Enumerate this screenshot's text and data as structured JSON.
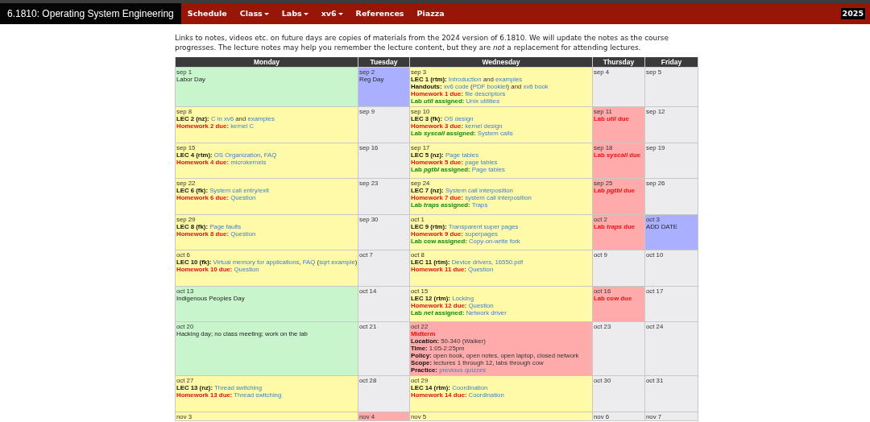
{
  "site_title": "6.1810: Operating System Engineering",
  "nav": [
    {
      "label": "Schedule",
      "dropdown": false
    },
    {
      "label": "Class",
      "dropdown": true
    },
    {
      "label": "Labs",
      "dropdown": true
    },
    {
      "label": "xv6",
      "dropdown": true
    },
    {
      "label": "References",
      "dropdown": false
    },
    {
      "label": "Piazza",
      "dropdown": false
    }
  ],
  "year": "2025",
  "intro": "Links to notes, videos etc. on future days are copies of materials from the 2024 version of 6.1810. We will update the notes as the course progresses. The lecture notes may help you remember the lecture content, but they are *not* a replacement for attending lectures.",
  "days": [
    "Monday",
    "Tuesday",
    "Wednesday",
    "Thursday",
    "Friday"
  ],
  "weeks": [
    [
      {
        "date": "sep 1",
        "kind": "holiday",
        "lines": [
          {
            "kind": "note",
            "parts": [
              {
                "text": "Labor Day"
              }
            ]
          }
        ]
      },
      {
        "date": "sep 2",
        "kind": "special",
        "lines": [
          {
            "kind": "note",
            "parts": [
              {
                "text": "Reg Day"
              }
            ]
          }
        ]
      },
      {
        "date": "sep 3",
        "kind": "class",
        "lines": [
          {
            "kind": "lec",
            "label": "LEC 1 (rtm):",
            "parts": [
              {
                "text": "Introduction",
                "link": true
              },
              {
                "text": " and "
              },
              {
                "text": "examples",
                "link": true
              }
            ]
          },
          {
            "kind": "lec",
            "label": "Handouts:",
            "parts": [
              {
                "text": "xv6 code",
                "link": true
              },
              {
                "text": " ("
              },
              {
                "text": "PDF booklet",
                "link": true
              },
              {
                "text": ") and "
              },
              {
                "text": "xv6 book",
                "link": true
              }
            ]
          },
          {
            "kind": "hw",
            "label": "Homework 1 due:",
            "parts": [
              {
                "text": "file descriptors",
                "link": true
              }
            ]
          },
          {
            "kind": "lab",
            "label": "Lab *util* assigned:",
            "parts": [
              {
                "text": "Unix utilities",
                "link": true
              }
            ]
          }
        ]
      },
      {
        "date": "sep 4",
        "kind": "empty"
      },
      {
        "date": "sep 5",
        "kind": "empty"
      }
    ],
    [
      {
        "date": "sep 8",
        "kind": "class",
        "lines": [
          {
            "kind": "lec",
            "label": "LEC 2 (nz):",
            "parts": [
              {
                "text": "C in xv6",
                "link": true
              },
              {
                "text": " and "
              },
              {
                "text": "examples",
                "link": true
              }
            ]
          },
          {
            "kind": "hw",
            "label": "Homework 2 due:",
            "parts": [
              {
                "text": "kernel C",
                "link": true
              }
            ]
          }
        ]
      },
      {
        "date": "sep 9",
        "kind": "empty"
      },
      {
        "date": "sep 10",
        "kind": "class",
        "lines": [
          {
            "kind": "lec",
            "label": "LEC 3 (fk):",
            "parts": [
              {
                "text": "OS design",
                "link": true
              }
            ]
          },
          {
            "kind": "hw",
            "label": "Homework 3 due:",
            "parts": [
              {
                "text": "kernel design",
                "link": true
              }
            ]
          },
          {
            "kind": "lab",
            "label": "Lab *syscall* assigned:",
            "parts": [
              {
                "text": "System calls",
                "link": true
              }
            ]
          }
        ]
      },
      {
        "date": "sep 11",
        "kind": "due",
        "lines": [
          {
            "kind": "hw",
            "label": "Lab *util* due"
          }
        ]
      },
      {
        "date": "sep 12",
        "kind": "empty"
      }
    ],
    [
      {
        "date": "sep 15",
        "kind": "class",
        "lines": [
          {
            "kind": "lec",
            "label": "LEC 4 (rtm):",
            "parts": [
              {
                "text": "OS Organization",
                "link": true
              },
              {
                "text": ", "
              },
              {
                "text": "FAQ",
                "link": true
              }
            ]
          },
          {
            "kind": "hw",
            "label": "Homework 4 due:",
            "parts": [
              {
                "text": "microkernels",
                "link": true
              }
            ]
          }
        ]
      },
      {
        "date": "sep 16",
        "kind": "empty"
      },
      {
        "date": "sep 17",
        "kind": "class",
        "lines": [
          {
            "kind": "lec",
            "label": "LEC 5 (nz):",
            "parts": [
              {
                "text": "Page tables",
                "link": true
              }
            ]
          },
          {
            "kind": "hw",
            "label": "Homework 5 due:",
            "parts": [
              {
                "text": "page tables",
                "link": true
              }
            ]
          },
          {
            "kind": "lab",
            "label": "Lab *pgtbl* assigned:",
            "parts": [
              {
                "text": "Page tables",
                "link": true
              }
            ]
          }
        ]
      },
      {
        "date": "sep 18",
        "kind": "due",
        "lines": [
          {
            "kind": "hw",
            "label": "Lab *syscall* due"
          }
        ]
      },
      {
        "date": "sep 19",
        "kind": "empty"
      }
    ],
    [
      {
        "date": "sep 22",
        "kind": "class",
        "lines": [
          {
            "kind": "lec",
            "label": "LEC 6 (fk):",
            "parts": [
              {
                "text": "System call entry/exit",
                "link": true
              }
            ]
          },
          {
            "kind": "hw",
            "label": "Homework 6 due:",
            "parts": [
              {
                "text": "Question",
                "link": true
              }
            ]
          }
        ]
      },
      {
        "date": "sep 23",
        "kind": "empty"
      },
      {
        "date": "sep 24",
        "kind": "class",
        "lines": [
          {
            "kind": "lec",
            "label": "LEC 7 (nz):",
            "parts": [
              {
                "text": "System call interposition",
                "link": true
              }
            ]
          },
          {
            "kind": "hw",
            "label": "Homework 7 due:",
            "parts": [
              {
                "text": "system call interposition",
                "link": true
              }
            ]
          },
          {
            "kind": "lab",
            "label": "Lab *traps* assigned:",
            "parts": [
              {
                "text": "Traps",
                "link": true
              }
            ]
          }
        ]
      },
      {
        "date": "sep 25",
        "kind": "due",
        "lines": [
          {
            "kind": "hw",
            "label": "Lab *pgtbl* due"
          }
        ]
      },
      {
        "date": "sep 26",
        "kind": "empty"
      }
    ],
    [
      {
        "date": "sep 29",
        "kind": "class",
        "lines": [
          {
            "kind": "lec",
            "label": "LEC 8 (fk):",
            "parts": [
              {
                "text": "Page faults",
                "link": true
              }
            ]
          },
          {
            "kind": "hw",
            "label": "Homework 8 due:",
            "parts": [
              {
                "text": "Question",
                "link": true
              }
            ]
          }
        ]
      },
      {
        "date": "sep 30",
        "kind": "empty"
      },
      {
        "date": "oct 1",
        "kind": "class",
        "lines": [
          {
            "kind": "lec",
            "label": "LEC 9 (rtm):",
            "parts": [
              {
                "text": "Transparent super pages",
                "link": true
              }
            ]
          },
          {
            "kind": "hw",
            "label": "Homework 9 due:",
            "parts": [
              {
                "text": "superpages",
                "link": true
              }
            ]
          },
          {
            "kind": "lab",
            "label": "Lab cow assigned:",
            "parts": [
              {
                "text": "Copy-on-write fork",
                "link": true
              }
            ]
          }
        ]
      },
      {
        "date": "oct 2",
        "kind": "due",
        "lines": [
          {
            "kind": "hw",
            "label": "Lab *traps* due"
          }
        ]
      },
      {
        "date": "oct 3",
        "kind": "special",
        "lines": [
          {
            "kind": "note",
            "parts": [
              {
                "text": "ADD DATE"
              }
            ]
          }
        ]
      }
    ],
    [
      {
        "date": "oct 6",
        "kind": "class",
        "lines": [
          {
            "kind": "lec",
            "label": "LEC 10 (fk):",
            "parts": [
              {
                "text": "Virtual memory for applications",
                "link": true
              },
              {
                "text": ", "
              },
              {
                "text": "FAQ",
                "link": true
              },
              {
                "text": " ("
              },
              {
                "text": "sqrt example",
                "link": true
              },
              {
                "text": ")"
              }
            ]
          },
          {
            "kind": "hw",
            "label": "Homework 10 due:",
            "parts": [
              {
                "text": "Question",
                "link": true
              }
            ]
          }
        ]
      },
      {
        "date": "oct 7",
        "kind": "empty"
      },
      {
        "date": "oct 8",
        "kind": "class",
        "lines": [
          {
            "kind": "lec",
            "label": "LEC 11 (rtm):",
            "parts": [
              {
                "text": "Device drivers, 16550.pdf",
                "link": true
              }
            ]
          },
          {
            "kind": "hw",
            "label": "Homework 11 due:",
            "parts": [
              {
                "text": "Question",
                "link": true
              }
            ]
          }
        ]
      },
      {
        "date": "oct 9",
        "kind": "empty"
      },
      {
        "date": "oct 10",
        "kind": "empty"
      }
    ],
    [
      {
        "date": "oct 13",
        "kind": "holiday",
        "lines": [
          {
            "kind": "note",
            "parts": [
              {
                "text": "Indigenous Peoples Day"
              }
            ]
          }
        ]
      },
      {
        "date": "oct 14",
        "kind": "empty"
      },
      {
        "date": "oct 15",
        "kind": "class",
        "lines": [
          {
            "kind": "lec",
            "label": "LEC 12 (rtm):",
            "parts": [
              {
                "text": "Locking",
                "link": true
              }
            ]
          },
          {
            "kind": "hw",
            "label": "Homework 12 due:",
            "parts": [
              {
                "text": "Question",
                "link": true
              }
            ]
          },
          {
            "kind": "lab",
            "label": "Lab *net* assigned:",
            "parts": [
              {
                "text": "Network driver",
                "link": true
              }
            ]
          }
        ]
      },
      {
        "date": "oct 16",
        "kind": "due",
        "lines": [
          {
            "kind": "hw",
            "label": "Lab cow due"
          }
        ]
      },
      {
        "date": "oct 17",
        "kind": "empty"
      }
    ],
    [
      {
        "date": "oct 20",
        "kind": "holiday",
        "lines": [
          {
            "kind": "note",
            "parts": [
              {
                "text": "Hacking day; no class meeting; work on the lab"
              }
            ]
          }
        ]
      },
      {
        "date": "oct 21",
        "kind": "empty"
      },
      {
        "date": "oct 22",
        "kind": "due",
        "lines": [
          {
            "kind": "hw",
            "label": "Midterm"
          },
          {
            "kind": "lec",
            "label": "Location:",
            "parts": [
              {
                "text": " 50-340 (Walker)"
              }
            ]
          },
          {
            "kind": "lec",
            "label": "Time:",
            "parts": [
              {
                "text": " 1:05-2:25pm"
              }
            ]
          },
          {
            "kind": "lec",
            "label": "Policy:",
            "parts": [
              {
                "text": " open book, open notes, open laptop, closed network"
              }
            ]
          },
          {
            "kind": "lec",
            "label": "Scope:",
            "parts": [
              {
                "text": " lectures 1 through 12, labs through cow"
              }
            ]
          },
          {
            "kind": "lec",
            "label": "Practice:",
            "parts": [
              {
                "text": "previous quizzes",
                "link": true
              }
            ]
          }
        ]
      },
      {
        "date": "oct 23",
        "kind": "empty"
      },
      {
        "date": "oct 24",
        "kind": "empty"
      }
    ],
    [
      {
        "date": "oct 27",
        "kind": "class",
        "lines": [
          {
            "kind": "lec",
            "label": "LEC 13 (nz):",
            "parts": [
              {
                "text": "Thread switching",
                "link": true
              }
            ]
          },
          {
            "kind": "hw",
            "label": "Homework 13 due:",
            "parts": [
              {
                "text": "Thread switching",
                "link": true
              }
            ]
          }
        ]
      },
      {
        "date": "oct 28",
        "kind": "empty"
      },
      {
        "date": "oct 29",
        "kind": "class",
        "lines": [
          {
            "kind": "lec",
            "label": "LEC 14 (rtm):",
            "parts": [
              {
                "text": "Coordination",
                "link": true
              }
            ]
          },
          {
            "kind": "hw",
            "label": "Homework 14 due:",
            "parts": [
              {
                "text": "Coordination",
                "link": true
              }
            ]
          }
        ]
      },
      {
        "date": "oct 30",
        "kind": "empty"
      },
      {
        "date": "oct 31",
        "kind": "empty"
      }
    ],
    [
      {
        "date": "nov 3",
        "kind": "class"
      },
      {
        "date": "nov 4",
        "kind": "due"
      },
      {
        "date": "nov 5",
        "kind": "class"
      },
      {
        "date": "nov 6",
        "kind": "empty"
      },
      {
        "date": "nov 7",
        "kind": "empty"
      }
    ]
  ]
}
